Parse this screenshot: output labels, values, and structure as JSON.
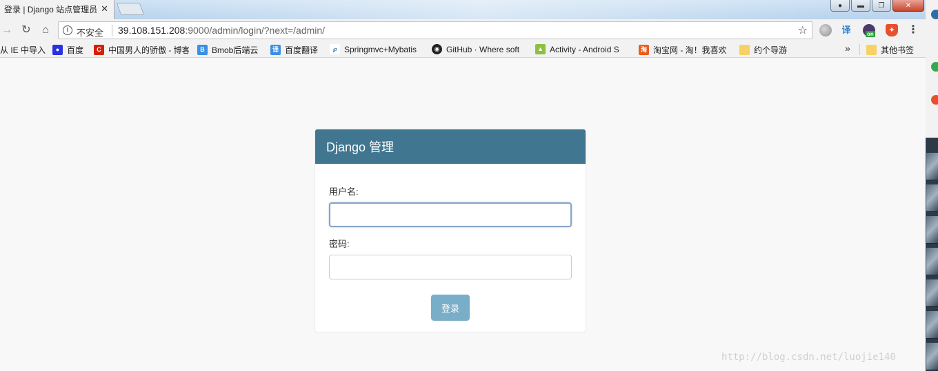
{
  "browser": {
    "active_tab_title": "登录 | Django 站点管理员",
    "tab_close": "✕",
    "address": {
      "security_label": "不安全",
      "url_host": "39.108.151.208",
      "url_path": ":9000/admin/login/?next=/admin/"
    },
    "extensions": {
      "translate": "译",
      "on_badge": "on"
    },
    "bookmarks": [
      {
        "label": "从 IE 中导入",
        "icon_color": ""
      },
      {
        "label": "百度",
        "icon_color": "#2932e1"
      },
      {
        "label": "中国男人的骄傲 - 博客",
        "icon_color": "#d81e06"
      },
      {
        "label": "Bmob后端云",
        "icon_color": "#3b8fe6"
      },
      {
        "label": "百度翻译",
        "icon_color": "#3b8fe6"
      },
      {
        "label": "Springmvc+Mybatis",
        "icon_color": "#1a5fa8"
      },
      {
        "label": "GitHub · Where soft",
        "icon_color": "#222222"
      },
      {
        "label": "Activity - Android S",
        "icon_color": "#8cc13f"
      },
      {
        "label": "淘宝网 - 淘！我喜欢",
        "icon_color": "#f05a1a"
      },
      {
        "label": "约个导游",
        "icon_color": "#f6d264"
      }
    ],
    "bookmarks_more": "»",
    "other_bookmarks": "其他书签"
  },
  "login": {
    "header_title": "Django 管理",
    "username_label": "用户名:",
    "username_value": "",
    "password_label": "密码:",
    "password_value": "",
    "submit_label": "登录"
  },
  "watermark": "http://blog.csdn.net/luojie140",
  "colors": {
    "header_bg": "#417690",
    "button_bg": "#79aec8",
    "page_bg": "#f8f8f8"
  }
}
